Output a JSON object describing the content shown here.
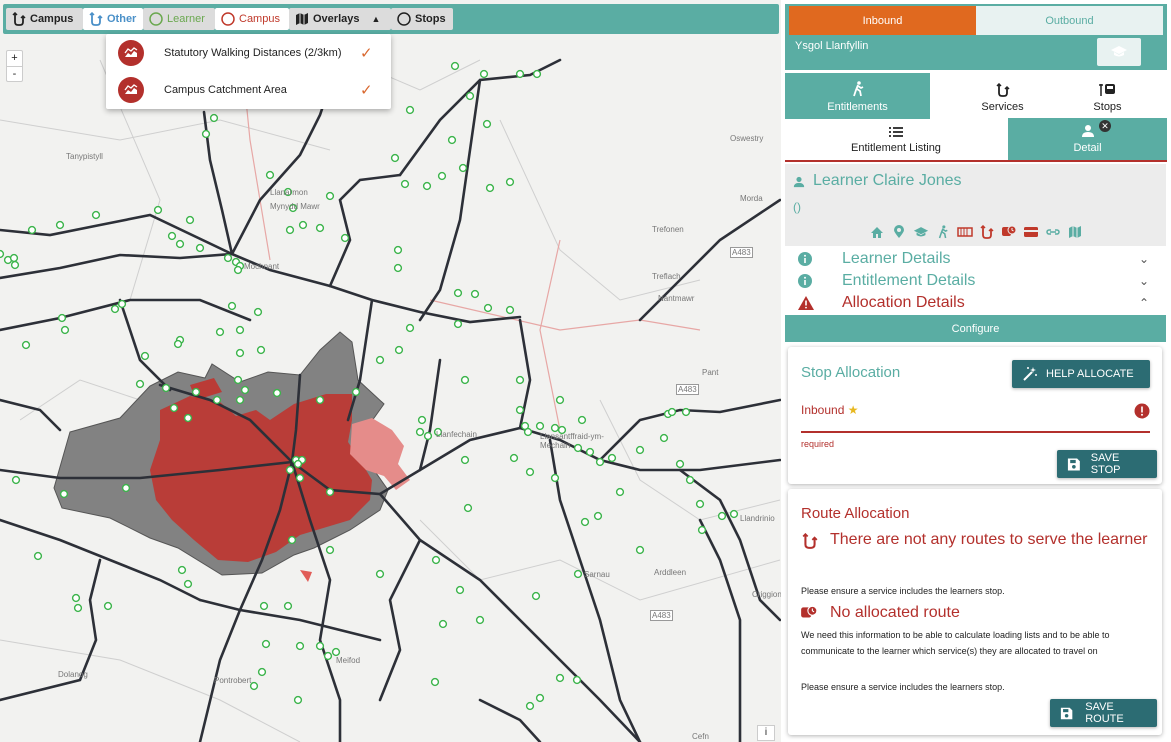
{
  "map": {
    "toolbar": {
      "campus": "Campus",
      "other": "Other",
      "learner": "Learner",
      "campus2": "Campus",
      "overlays": "Overlays",
      "stops": "Stops"
    },
    "overlay_menu": [
      {
        "label": "Statutory Walking Distances (2/3km)",
        "checked": true
      },
      {
        "label": "Campus Catchment Area",
        "checked": true
      }
    ],
    "zoom_in": "+",
    "zoom_out": "-",
    "info": "i",
    "place_labels": [
      {
        "text": "Tanypistyll"
      },
      {
        "text": "Llanarmon"
      },
      {
        "text": "Mynydd Mawr"
      },
      {
        "text": "Oswestry"
      },
      {
        "text": "Morda"
      },
      {
        "text": "Trefonen"
      },
      {
        "text": "Treflach"
      },
      {
        "text": "Nantmawr"
      },
      {
        "text": "A483"
      },
      {
        "text": "A483"
      },
      {
        "text": "A483"
      },
      {
        "text": "Pant"
      },
      {
        "text": "Llanfechain"
      },
      {
        "text": "Llansantffraid-ym-Mechain"
      },
      {
        "text": "Meifod"
      },
      {
        "text": "Dolanog"
      },
      {
        "text": "Pontrobert"
      },
      {
        "text": "Sarnau"
      },
      {
        "text": "Arddleen"
      },
      {
        "text": "Criggion"
      },
      {
        "text": "Cefn"
      },
      {
        "text": "Llandrinio"
      },
      {
        "text": "Mochnant"
      }
    ]
  },
  "panel": {
    "inbound": "Inbound",
    "outbound": "Outbound",
    "school": "Ysgol Llanfyllin",
    "tabs": {
      "entitlements": "Entitlements",
      "services": "Services",
      "stops": "Stops"
    },
    "subtabs": {
      "listing": "Entitlement Listing",
      "detail": "Detail"
    },
    "learner": {
      "name": "Learner Claire Jones",
      "sub": "()"
    },
    "accordion": {
      "learner": "Learner Details",
      "entitlement": "Entitlement Details",
      "allocation": "Allocation Details"
    },
    "configure": "Configure",
    "stop_allocation": {
      "title": "Stop Allocation",
      "help_btn": "HELP ALLOCATE",
      "field_label": "Inbound",
      "required": "required",
      "save_btn": "SAVE STOP"
    },
    "route_allocation": {
      "title": "Route Allocation",
      "no_routes": "There are not any routes to serve the learner",
      "ensure1": "Please ensure a service includes the learners stop.",
      "no_allocated": "No allocated route",
      "info": "We need this information to be able to calculate loading lists and to be able to communicate to the learner which service(s) they are allocated to travel on",
      "ensure2": "Please ensure a service includes the learners stop.",
      "save_btn": "SAVE ROUTE"
    }
  },
  "colors": {
    "teal": "#5aada3",
    "orange": "#e0691f",
    "red": "#b3302c",
    "dark_teal": "#2c6c73"
  }
}
